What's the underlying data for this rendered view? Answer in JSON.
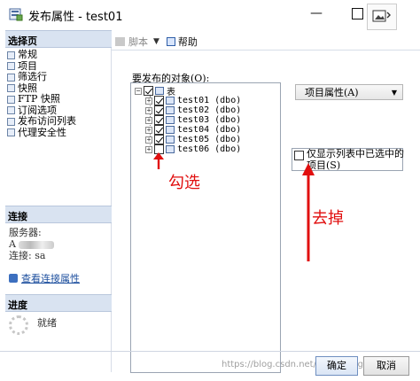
{
  "window": {
    "title": "发布属性 - test01",
    "min_glyph": "—"
  },
  "left_panel": {
    "select_page_heading": "选择页",
    "nav_items": [
      "常规",
      "项目",
      "筛选行",
      "快照",
      "FTP 快照",
      "订阅选项",
      "发布访问列表",
      "代理安全性"
    ],
    "connection_heading": "连接",
    "server_label": "服务器:",
    "server_value": "A",
    "connection_label": "连接:",
    "connection_value": "sa",
    "view_connection_link": "查看连接属性",
    "progress_heading": "进度",
    "progress_status": "就绪"
  },
  "toolbar": {
    "script_label": "脚本",
    "dropdown_arrow": "▼",
    "help_label": "帮助"
  },
  "main": {
    "objects_label": "要发布的对象(O):",
    "tree": {
      "root": "表",
      "tables": [
        {
          "name": "test01 (dbo)",
          "checked": true
        },
        {
          "name": "test02 (dbo)",
          "checked": true
        },
        {
          "name": "test03 (dbo)",
          "checked": true
        },
        {
          "name": "test04 (dbo)",
          "checked": true
        },
        {
          "name": "test05 (dbo)",
          "checked": true
        },
        {
          "name": "test06 (dbo)",
          "checked": false
        }
      ]
    },
    "article_properties_button": "项目属性(A)",
    "article_properties_arrow": "▼",
    "only_show_checked_label": "仅显示列表中已选中的项目(S)"
  },
  "annotations": {
    "check_label": "勾选",
    "remove_label": "去掉",
    "color": "#e10f0f"
  },
  "footer": {
    "ok_button": "确定",
    "cancel_button": "取消",
    "watermark": "https://blog.csdn.net/liangmeng"
  }
}
